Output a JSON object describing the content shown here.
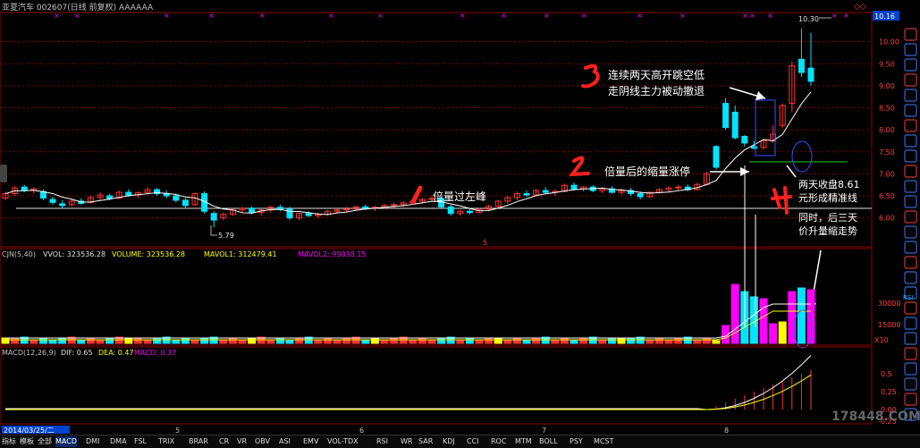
{
  "header": {
    "title": "亚夏汽车 002607(日线 前复权) AAAAAA",
    "top_right_badge": "◇◇",
    "price_scale_highlight": "10.16"
  },
  "price_axis": {
    "ticks": [
      "10.00",
      "9.50",
      "9.00",
      "8.50",
      "8.00",
      "7.50",
      "7.00",
      "6.50",
      "6.00"
    ],
    "range": [
      5.5,
      10.5
    ]
  },
  "price_labels": {
    "high": "10.30",
    "low": "5.79",
    "marker_5": "5"
  },
  "annotations": {
    "a1_num": "1",
    "a1_text": "倍量过左峰",
    "a2_num": "2",
    "a2_text": "倍量后的缩量涨停",
    "a3_num": "3",
    "a3_line1": "连续两天高开跳空低",
    "a3_line2": "走阴线主力被动撤退",
    "a4_num": "4",
    "a4_line1": "两天收盘8.61",
    "a4_line2": "元形成精准线",
    "a4_line3": "同时，后三天",
    "a4_line4": "价升量缩走势"
  },
  "volume_panel": {
    "header_prefix": "CJN(5,40)",
    "vvol": "VVOL: 323536.28",
    "volume": "VOLUME: 323536.28",
    "mavol1": "MAVOL1: 312479.41",
    "mavol2": "MAVOL2: 99038.15",
    "ticks": [
      "30000",
      "15000"
    ],
    "unit": "X10"
  },
  "macd_panel": {
    "header_prefix": "MACD(12,26,9)",
    "dif": "DIF: 0.65",
    "dea": "DEA: 0.47",
    "macd": "MACD: 0.37",
    "ticks": [
      "0.5",
      "0.25",
      "0.00",
      "-0.25"
    ]
  },
  "x_axis": {
    "cursor_date": "2014/03/25/二",
    "month_labels": [
      "5",
      "6",
      "7",
      "8"
    ],
    "watermark": "178448.COM"
  },
  "tabs": [
    "指标",
    "模板",
    "全部",
    "MACD",
    "DMI",
    "DMA",
    "FSL",
    "TRIX",
    "BRAR",
    "CR",
    "VR",
    "OBV",
    "ASI",
    "EMV",
    "VOL-TDX",
    "RSI",
    "WR",
    "SAR",
    "KDJ",
    "CCI",
    "ROC",
    "MTM",
    "BOLL",
    "PSY",
    "MCST"
  ],
  "sidebar_icons": [
    "RSI"
  ],
  "colors": {
    "up": "#ff3232",
    "down": "#00e4ff",
    "ma5": "#ffffff",
    "ma_yellow": "#ffff00",
    "magenta": "#ff00ff",
    "grid": "#8b0000"
  },
  "chart_data": {
    "type": "candlestick",
    "note_keys": [
      "open",
      "high",
      "low",
      "close"
    ],
    "candles": [
      [
        6.45,
        6.6,
        6.4,
        6.55
      ],
      [
        6.55,
        6.72,
        6.5,
        6.68
      ],
      [
        6.7,
        6.75,
        6.58,
        6.62
      ],
      [
        6.62,
        6.7,
        6.55,
        6.66
      ],
      [
        6.6,
        6.65,
        6.4,
        6.45
      ],
      [
        6.42,
        6.48,
        6.3,
        6.35
      ],
      [
        6.32,
        6.4,
        6.22,
        6.28
      ],
      [
        6.3,
        6.42,
        6.25,
        6.38
      ],
      [
        6.38,
        6.45,
        6.3,
        6.33
      ],
      [
        6.35,
        6.5,
        6.32,
        6.46
      ],
      [
        6.46,
        6.58,
        6.4,
        6.52
      ],
      [
        6.5,
        6.55,
        6.4,
        6.44
      ],
      [
        6.45,
        6.62,
        6.42,
        6.58
      ],
      [
        6.58,
        6.65,
        6.48,
        6.52
      ],
      [
        6.52,
        6.6,
        6.45,
        6.57
      ],
      [
        6.58,
        6.7,
        6.52,
        6.64
      ],
      [
        6.64,
        6.68,
        6.5,
        6.55
      ],
      [
        6.55,
        6.62,
        6.45,
        6.5
      ],
      [
        6.5,
        6.55,
        6.35,
        6.4
      ],
      [
        6.4,
        6.45,
        6.22,
        6.28
      ],
      [
        6.3,
        6.58,
        6.28,
        6.55
      ],
      [
        6.55,
        6.6,
        6.1,
        6.15
      ],
      [
        6.1,
        6.15,
        5.79,
        5.95
      ],
      [
        6.0,
        6.12,
        5.95,
        6.08
      ],
      [
        6.08,
        6.22,
        6.05,
        6.18
      ],
      [
        6.18,
        6.25,
        6.1,
        6.22
      ],
      [
        6.22,
        6.26,
        6.08,
        6.12
      ],
      [
        6.12,
        6.2,
        6.05,
        6.18
      ],
      [
        6.18,
        6.28,
        6.12,
        6.24
      ],
      [
        6.24,
        6.3,
        6.15,
        6.2
      ],
      [
        6.2,
        6.25,
        5.95,
        6.0
      ],
      [
        6.0,
        6.12,
        5.95,
        6.1
      ],
      [
        6.1,
        6.15,
        6.02,
        6.05
      ],
      [
        6.05,
        6.12,
        6.0,
        6.08
      ],
      [
        6.08,
        6.18,
        6.05,
        6.15
      ],
      [
        6.15,
        6.22,
        6.1,
        6.18
      ],
      [
        6.18,
        6.25,
        6.12,
        6.2
      ],
      [
        6.2,
        6.28,
        6.15,
        6.25
      ],
      [
        6.25,
        6.3,
        6.18,
        6.22
      ],
      [
        6.22,
        6.28,
        6.15,
        6.24
      ],
      [
        6.24,
        6.32,
        6.2,
        6.28
      ],
      [
        6.28,
        6.35,
        6.22,
        6.3
      ],
      [
        6.3,
        6.38,
        6.25,
        6.34
      ],
      [
        6.34,
        6.42,
        6.3,
        6.38
      ],
      [
        6.38,
        6.45,
        6.32,
        6.42
      ],
      [
        6.42,
        6.5,
        6.38,
        6.44
      ],
      [
        6.44,
        6.48,
        6.2,
        6.25
      ],
      [
        6.25,
        6.3,
        6.05,
        6.1
      ],
      [
        6.1,
        6.18,
        6.05,
        6.15
      ],
      [
        6.15,
        6.2,
        6.08,
        6.12
      ],
      [
        6.12,
        6.22,
        6.1,
        6.2
      ],
      [
        6.2,
        6.3,
        6.15,
        6.26
      ],
      [
        6.26,
        6.4,
        6.22,
        6.38
      ],
      [
        6.38,
        6.5,
        6.32,
        6.46
      ],
      [
        6.46,
        6.6,
        6.4,
        6.55
      ],
      [
        6.55,
        6.62,
        6.48,
        6.52
      ],
      [
        6.52,
        6.65,
        6.5,
        6.62
      ],
      [
        6.62,
        6.7,
        6.55,
        6.58
      ],
      [
        6.58,
        6.65,
        6.5,
        6.6
      ],
      [
        6.6,
        6.78,
        6.58,
        6.74
      ],
      [
        6.74,
        6.8,
        6.62,
        6.66
      ],
      [
        6.66,
        6.72,
        6.6,
        6.7
      ],
      [
        6.7,
        6.74,
        6.58,
        6.62
      ],
      [
        6.62,
        6.7,
        6.56,
        6.66
      ],
      [
        6.66,
        6.72,
        6.55,
        6.58
      ],
      [
        6.58,
        6.66,
        6.52,
        6.62
      ],
      [
        6.62,
        6.68,
        6.5,
        6.55
      ],
      [
        6.55,
        6.6,
        6.42,
        6.48
      ],
      [
        6.48,
        6.6,
        6.45,
        6.58
      ],
      [
        6.58,
        6.68,
        6.55,
        6.64
      ],
      [
        6.64,
        6.72,
        6.58,
        6.68
      ],
      [
        6.68,
        6.75,
        6.62,
        6.7
      ],
      [
        6.7,
        6.76,
        6.6,
        6.64
      ],
      [
        6.64,
        6.8,
        6.62,
        6.76
      ],
      [
        6.76,
        7.05,
        6.74,
        7.0
      ],
      [
        7.62,
        7.65,
        7.1,
        7.15
      ],
      [
        8.6,
        8.72,
        8.0,
        8.05
      ],
      [
        8.4,
        8.55,
        7.78,
        7.82
      ],
      [
        7.85,
        7.88,
        7.62,
        7.7
      ],
      [
        7.62,
        7.75,
        7.55,
        7.58
      ],
      [
        7.6,
        7.8,
        7.55,
        7.75
      ],
      [
        7.75,
        8.1,
        7.7,
        7.9
      ],
      [
        8.1,
        8.6,
        8.05,
        8.55
      ],
      [
        8.6,
        9.55,
        8.4,
        9.45
      ],
      [
        9.6,
        10.3,
        9.2,
        9.3
      ],
      [
        9.4,
        10.2,
        9.0,
        9.1
      ]
    ]
  }
}
